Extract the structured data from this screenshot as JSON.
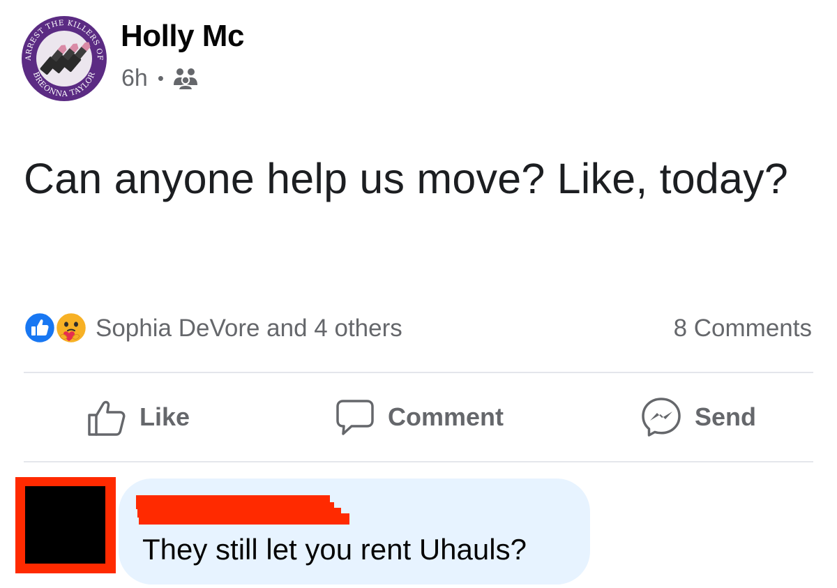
{
  "post": {
    "author": "Holly Mc",
    "time": "6h",
    "separator": "•",
    "audience_icon": "friends-icon",
    "avatar": {
      "badge_text_top": "ARREST THE KILLERS OF",
      "badge_text_bottom": "BREONNA TAYLOR"
    },
    "text": "Can anyone help us move? Like, today?"
  },
  "reactions": {
    "icons": [
      "like-reaction-icon",
      "care-reaction-icon"
    ],
    "summary": "Sophia DeVore and 4 others",
    "comments": "8 Comments"
  },
  "actions": {
    "like": "Like",
    "comment": "Comment",
    "send": "Send"
  },
  "comment": {
    "text": "They still let you rent Uhauls?"
  },
  "colors": {
    "secondary_text": "#65676b",
    "like_blue": "#1877f2",
    "bubble_bg": "#e7f3ff",
    "redaction_red": "#ff2a00",
    "badge_purple": "#5b2b83"
  }
}
